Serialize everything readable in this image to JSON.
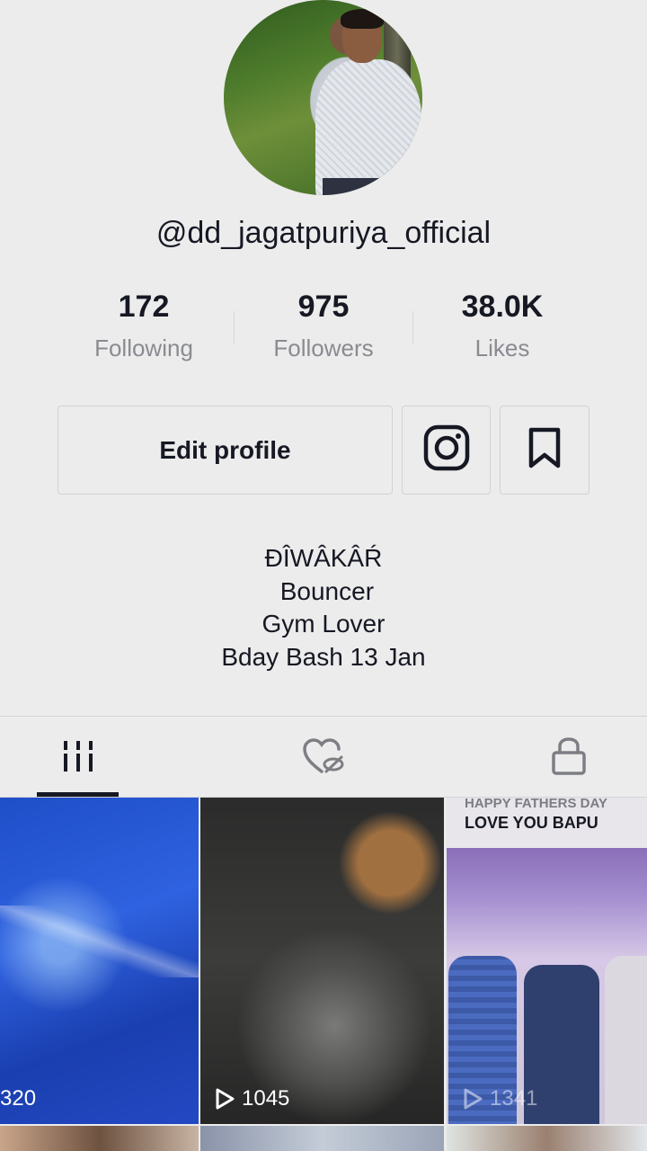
{
  "profile": {
    "username": "@dd_jagatpuriya_official",
    "avatar_icon": "profile-photo"
  },
  "stats": {
    "following": {
      "value": "172",
      "label": "Following"
    },
    "followers": {
      "value": "975",
      "label": "Followers"
    },
    "likes": {
      "value": "38.0K",
      "label": "Likes"
    }
  },
  "actions": {
    "edit_label": "Edit profile",
    "instagram_icon": "instagram-icon",
    "bookmark_icon": "bookmark-icon"
  },
  "bio": {
    "lines": [
      "ĐÎWÂKÂŔ",
      " Bouncer",
      "Gym Lover",
      "Bday Bash 13 Jan"
    ]
  },
  "tabs": [
    {
      "icon": "videos-grid-icon",
      "active": true
    },
    {
      "icon": "liked-hidden-icon",
      "active": false
    },
    {
      "icon": "lock-icon",
      "active": false
    }
  ],
  "videos": [
    {
      "views": "320"
    },
    {
      "views": "1045"
    },
    {
      "views": "1341",
      "caption_top": "HAPPY FATHERS DAY",
      "caption": "LOVE YOU BAPU"
    }
  ],
  "colors": {
    "background": "#ececec",
    "text_primary": "#161823",
    "text_secondary": "#8a8b91"
  }
}
